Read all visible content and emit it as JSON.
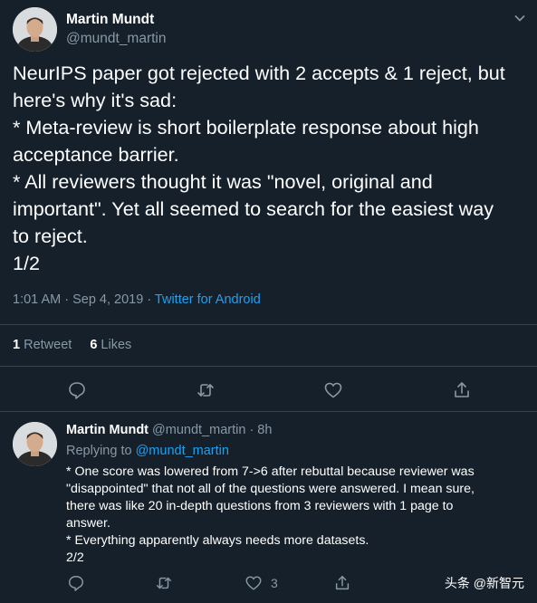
{
  "tweet": {
    "author_name": "Martin Mundt",
    "author_handle": "@mundt_martin",
    "lines": [
      "NeurIPS paper got rejected with 2 accepts & 1 reject, but",
      "here's why it's sad:",
      "* Meta-review is short boilerplate response about high",
      "acceptance barrier.",
      "* All reviewers thought it was \"novel, original and",
      "important\". Yet all seemed to search for the easiest way",
      "to reject.",
      "1/2"
    ],
    "timestamp": "1:01 AM · Sep 4, 2019 · ",
    "source": "Twitter for Android",
    "retweet_count": "1",
    "retweet_label": "Retweet",
    "like_count": "6",
    "like_label": "Likes"
  },
  "reply": {
    "author_name": "Martin Mundt",
    "author_handle": "@mundt_martin",
    "time": " · 8h",
    "replying_label": "Replying to ",
    "replying_to": "@mundt_martin",
    "lines": [
      "* One score was lowered from 7->6 after rebuttal because reviewer was",
      "\"disappointed\" that not all of the questions were answered. I mean sure,",
      "there was like 20 in-depth questions from 3 reviewers with 1 page to",
      "answer.",
      "* Everything apparently always needs more datasets.",
      "2/2"
    ],
    "like_count": "3"
  },
  "watermark": "头条 @新智元",
  "icons": [
    "chevron-down-icon",
    "reply-icon",
    "retweet-icon",
    "like-icon",
    "share-icon"
  ],
  "colors": {
    "background": "#15202b",
    "muted": "#8899a6",
    "link": "#1da1f2",
    "divider": "#38444d"
  }
}
